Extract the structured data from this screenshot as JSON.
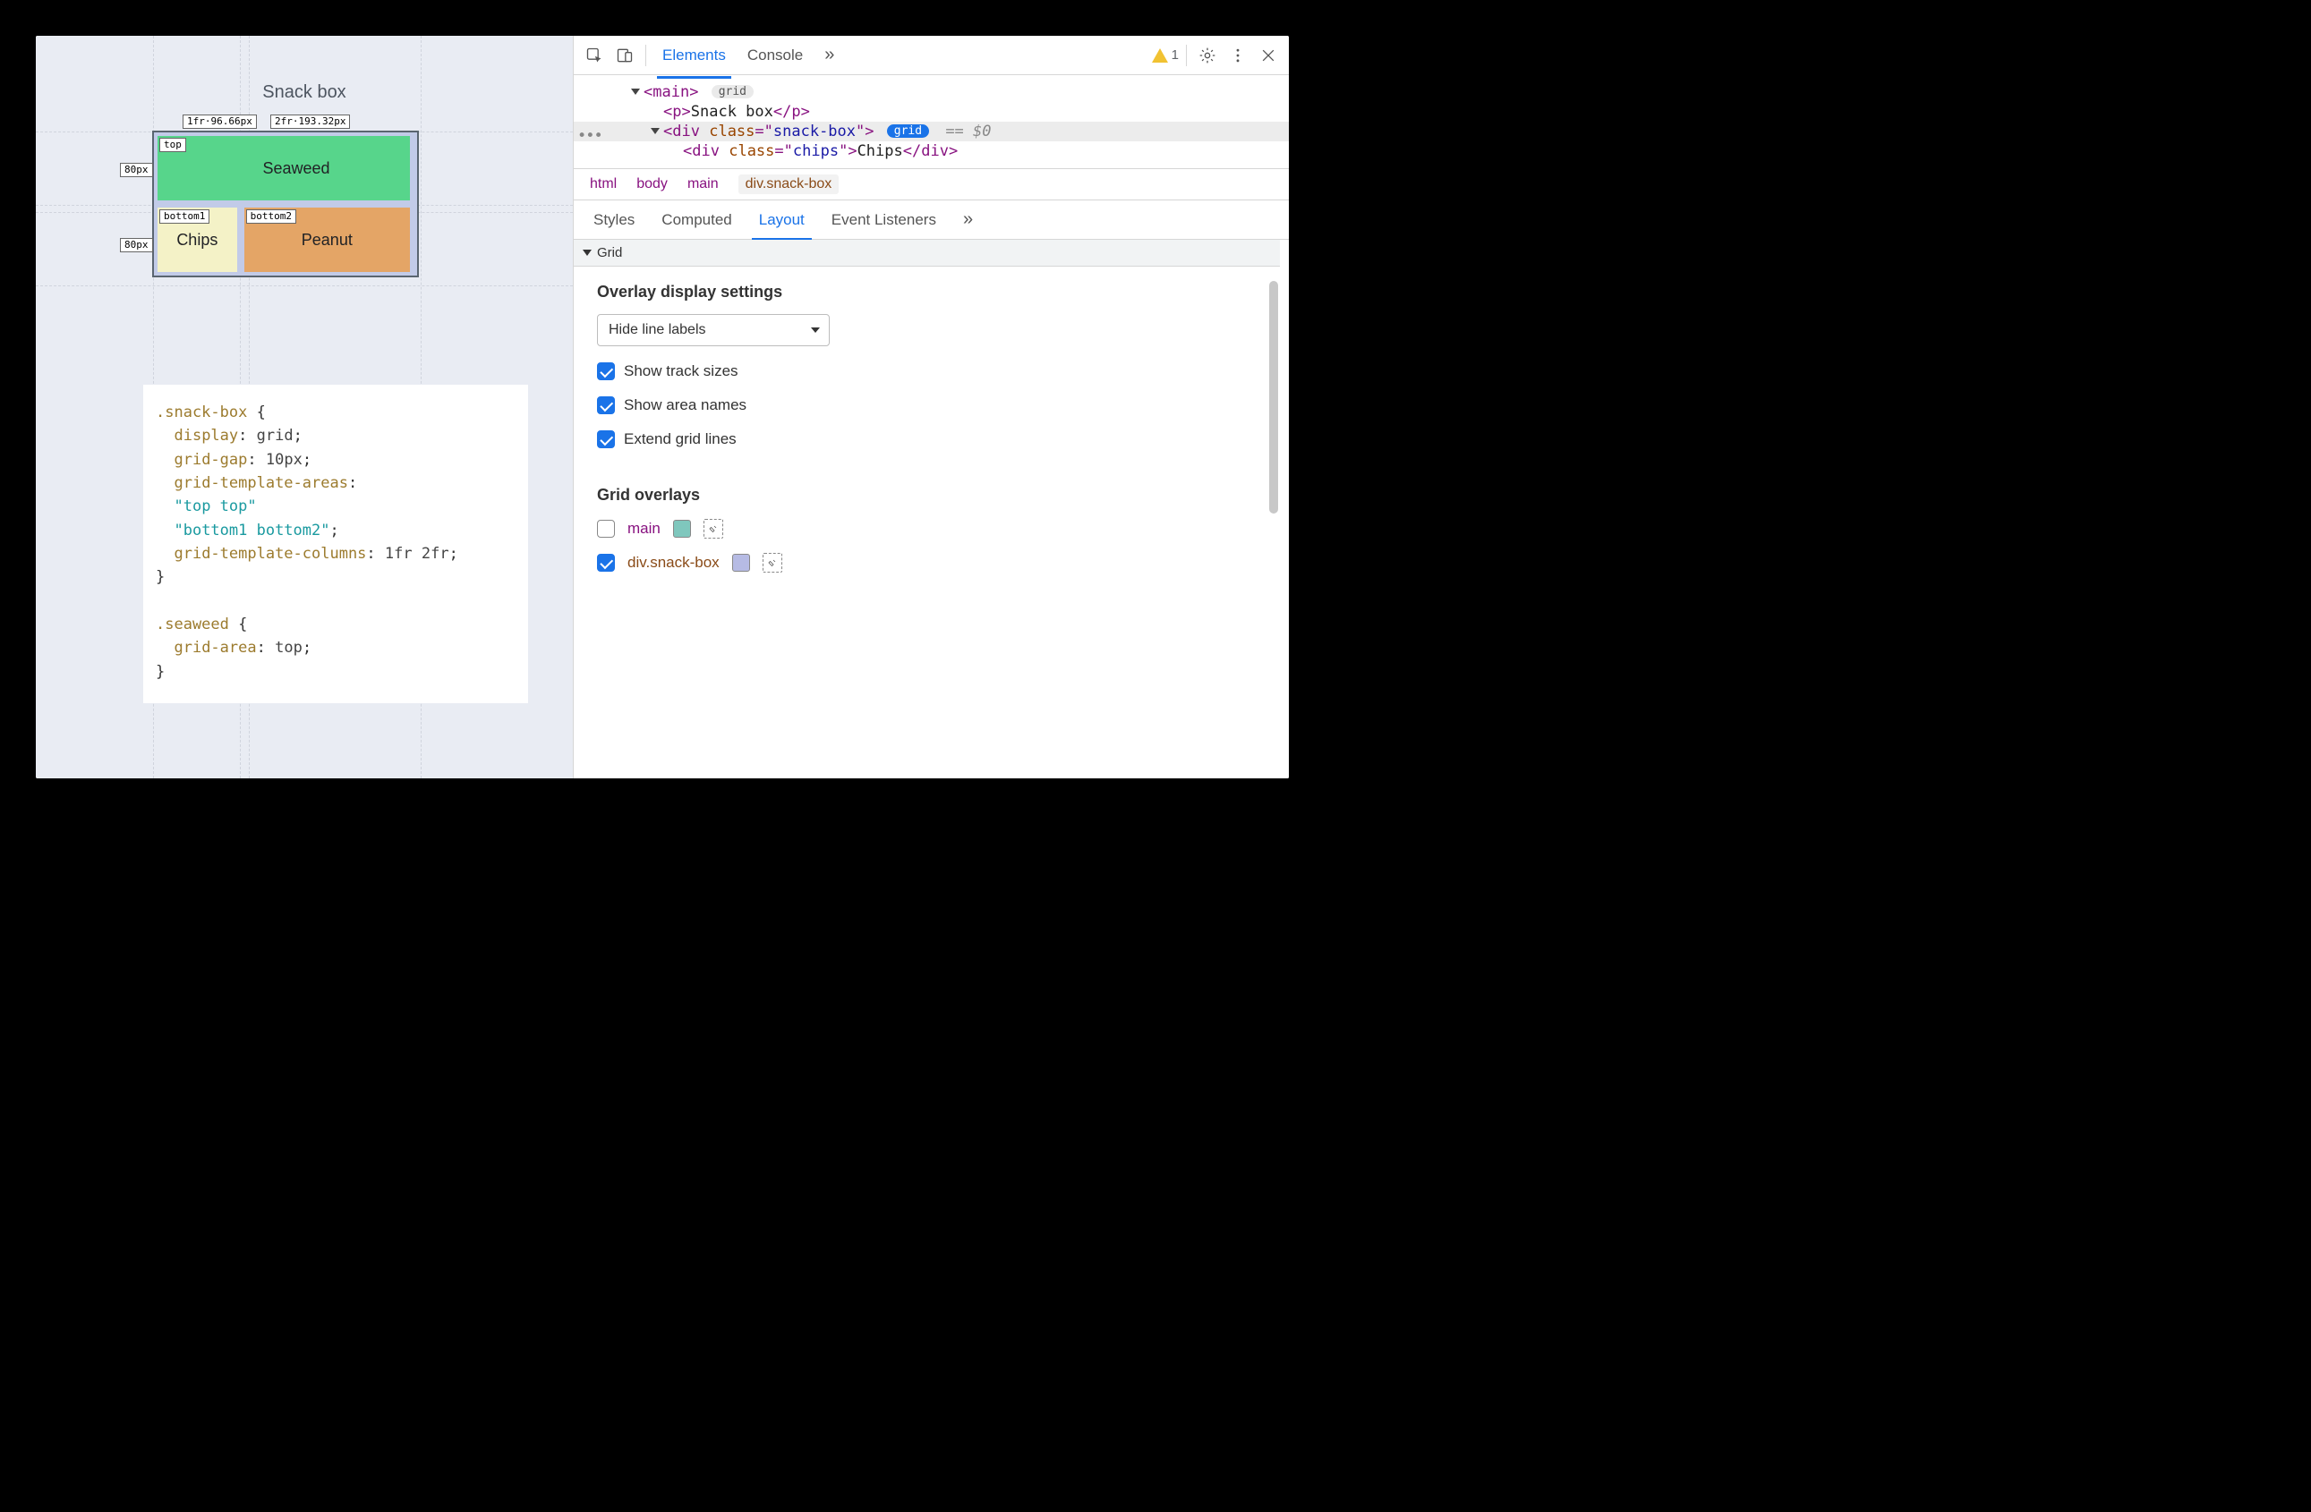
{
  "page": {
    "title": "Snack box",
    "grid": {
      "cols": [
        "1fr·96.66px",
        "2fr·193.32px"
      ],
      "rows": [
        "80px",
        "80px"
      ],
      "areas": {
        "top": "top",
        "bottom1": "bottom1",
        "bottom2": "bottom2"
      },
      "cells": {
        "seaweed": "Seaweed",
        "chips": "Chips",
        "peanut": "Peanut"
      }
    },
    "code": {
      "sel1": ".snack-box",
      "brace_o": " {",
      "lines": [
        {
          "prop": "display",
          "sep": ": ",
          "val": "grid",
          "end": ";"
        },
        {
          "prop": "grid-gap",
          "sep": ": ",
          "val": "10px",
          "end": ";"
        },
        {
          "prop": "grid-template-areas",
          "sep": ":",
          "val": "",
          "end": ""
        },
        {
          "str": "\"top top\""
        },
        {
          "str": "\"bottom1 bottom2\"",
          "end": ";"
        },
        {
          "prop": "grid-template-columns",
          "sep": ": ",
          "val": "1fr 2fr",
          "end": ";"
        }
      ],
      "brace_c": "}",
      "sel2": ".seaweed",
      "line2": {
        "prop": "grid-area",
        "sep": ": ",
        "val": "top",
        "end": ";"
      }
    }
  },
  "devtools": {
    "tabs": {
      "elements": "Elements",
      "console": "Console",
      "more": "»",
      "warn_count": "1"
    },
    "dom": {
      "main_open": "main",
      "grid_chip": "grid",
      "p_line": "Snack box",
      "div1_attr": "class",
      "div1_val": "snack-box",
      "div2_attr": "class",
      "div2_val": "chips",
      "div2_text": "Chips",
      "eq0": "== $0"
    },
    "crumbs": [
      "html",
      "body",
      "main",
      "div.snack-box"
    ],
    "subtabs": {
      "styles": "Styles",
      "computed": "Computed",
      "layout": "Layout",
      "events": "Event Listeners",
      "more": "»"
    },
    "layout": {
      "section": "Grid",
      "heading1": "Overlay display settings",
      "select_value": "Hide line labels",
      "checks": {
        "track_sizes": "Show track sizes",
        "area_names": "Show area names",
        "extend_lines": "Extend grid lines"
      },
      "heading2": "Grid overlays",
      "overlays": {
        "main": "main",
        "snack": "div.snack-box",
        "swatch_main": "#7fc7bd",
        "swatch_snack": "#b6bbe4"
      }
    }
  }
}
